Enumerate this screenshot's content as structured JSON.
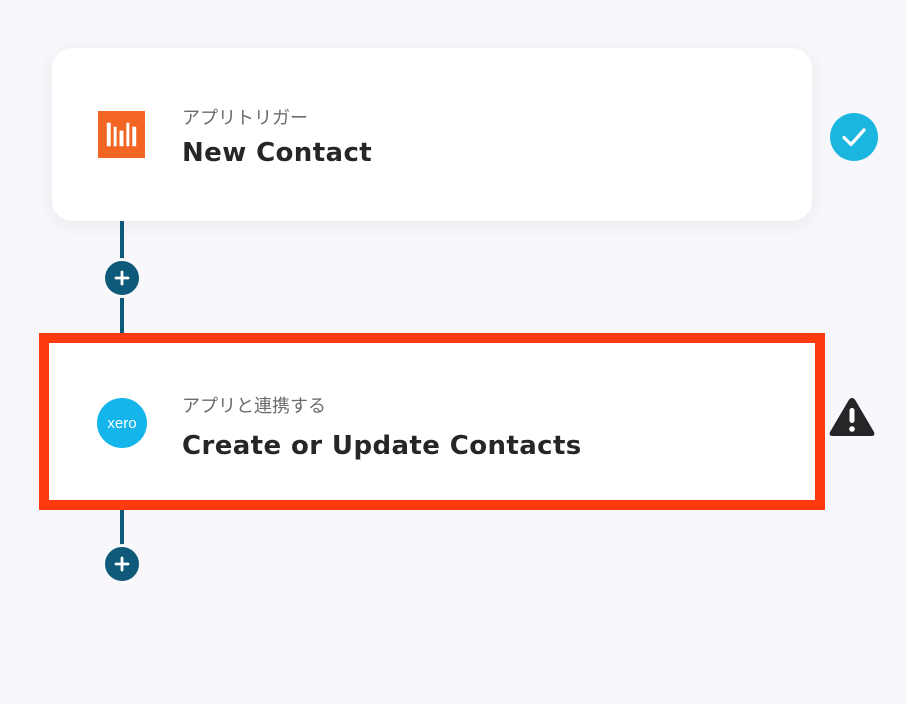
{
  "steps": [
    {
      "type_label": "アプリトリガー",
      "title": "New Contact",
      "app_icon": "hubspot-like-bars-logo",
      "status_icon": "check-circle-icon",
      "status_color": "#1bb6e0"
    },
    {
      "type_label": "アプリと連携する",
      "title": "Create or Update Contacts",
      "app_icon": "xero-logo",
      "app_logo_text": "xero",
      "status_icon": "warning-triangle-icon",
      "highlighted": true
    }
  ],
  "colors": {
    "connector": "#0f5a7a",
    "highlight_border": "#ff3a0e",
    "trigger_logo": "#f26522",
    "xero_blue": "#13b5ea",
    "warning": "#262629",
    "background": "#f8f7fb"
  }
}
